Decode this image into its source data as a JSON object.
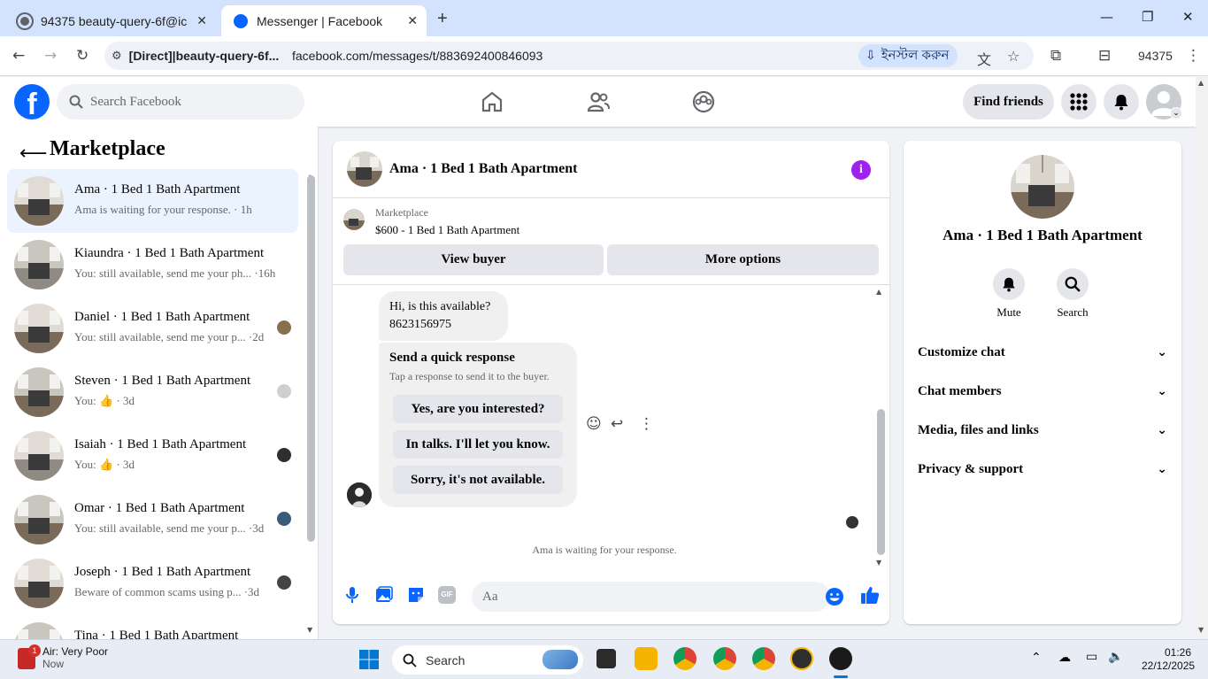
{
  "browser": {
    "tabs": [
      {
        "title": "94375 beauty-query-6f@ic",
        "active": false
      },
      {
        "title": "Messenger | Facebook",
        "active": true
      }
    ],
    "site_chip": "[Direct]|beauty-query-6f...",
    "url": "facebook.com/messages/t/883692400846093",
    "install_label": "ইনস্টল করুন",
    "profile_count": "94375"
  },
  "fb_header": {
    "search_placeholder": "Search Facebook",
    "find_friends": "Find friends"
  },
  "sidebar": {
    "title": "Marketplace",
    "conversations": [
      {
        "name": "Ama · 1 Bed 1 Bath Apartment",
        "preview": "Ama is waiting for your response. · 1h",
        "active": true
      },
      {
        "name": "Kiaundra · 1 Bed 1 Bath Apartment",
        "preview": "You: still available, send me your ph... ·16h",
        "active": false
      },
      {
        "name": "Daniel · 1 Bed 1 Bath Apartment",
        "preview": "You: still available, send me your p... ·2d",
        "active": false
      },
      {
        "name": "Steven · 1 Bed 1 Bath Apartment",
        "preview": "You: 👍 · 3d",
        "active": false
      },
      {
        "name": "Isaiah · 1 Bed 1 Bath Apartment",
        "preview": "You: 👍 · 3d",
        "active": false
      },
      {
        "name": "Omar · 1 Bed 1 Bath Apartment",
        "preview": "You: still available, send me your p... ·3d",
        "active": false
      },
      {
        "name": "Joseph · 1 Bed 1 Bath Apartment",
        "preview": "Beware of common scams using p... ·3d",
        "active": false
      },
      {
        "name": "Tina · 1 Bed 1 Bath Apartment",
        "preview": "",
        "active": false
      }
    ]
  },
  "chat": {
    "title": "Ama · 1 Bed 1 Bath Apartment",
    "listing_source": "Marketplace",
    "listing_title": "$600 - 1 Bed 1 Bath Apartment",
    "view_buyer": "View buyer",
    "more_options": "More options",
    "message_line1": "Hi, is this available?",
    "message_line2": "8623156975",
    "quick_title": "Send a quick response",
    "quick_subtitle": "Tap a response to send it to the buyer.",
    "quick_responses": [
      "Yes, are you interested?",
      "In talks. I'll let you know.",
      "Sorry, it's not available."
    ],
    "waiting_text": "Ama is waiting for your response.",
    "input_placeholder": "Aa",
    "gif_label": "GIF"
  },
  "details": {
    "title": "Ama · 1 Bed 1 Bath Apartment",
    "mute": "Mute",
    "search": "Search",
    "sections": [
      "Customize chat",
      "Chat members",
      "Media, files and links",
      "Privacy & support"
    ]
  },
  "taskbar": {
    "weather_title": "Air: Very Poor",
    "weather_sub": "Now",
    "weather_badge": "1",
    "search_placeholder": "Search",
    "time": "01:26",
    "date": "22/12/2025"
  },
  "colors": {
    "fb_blue": "#0866ff",
    "info_purple": "#a020f0",
    "active_row": "#ebf3ff"
  }
}
